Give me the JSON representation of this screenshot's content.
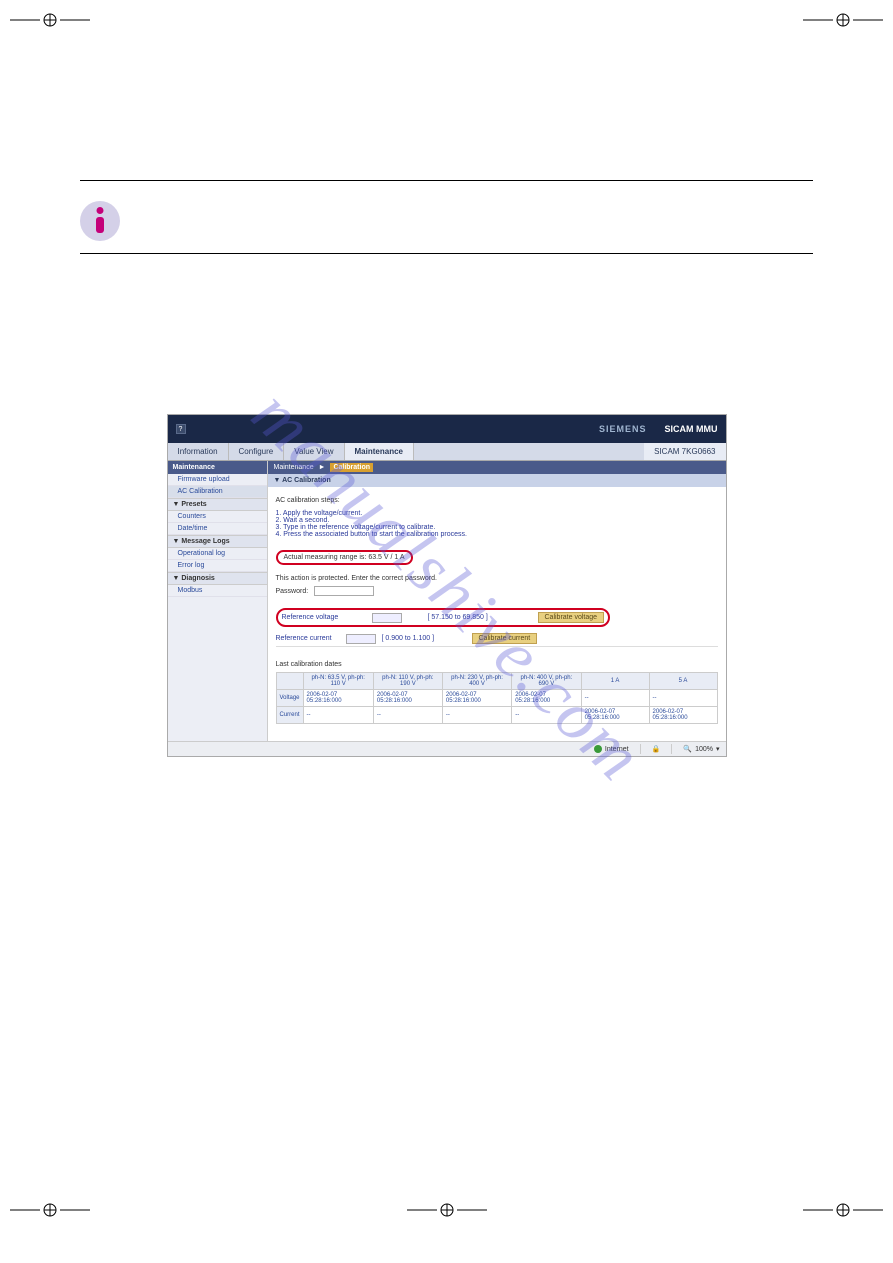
{
  "registration_mark": "⊕",
  "watermark": "manualshive.com",
  "app": {
    "help": "?",
    "brand": "SIEMENS",
    "product": "SICAM MMU",
    "device_id": "SICAM 7KG0663",
    "tabs": {
      "information": "Information",
      "configure": "Configure",
      "value_view": "Value View",
      "maintenance": "Maintenance"
    },
    "sidebar": {
      "head": "Maintenance",
      "firmware": "Firmware upload",
      "ac_cal": "AC Calibration",
      "presets_grp": "▼ Presets",
      "counters": "Counters",
      "datetime": "Date/time",
      "msglogs_grp": "▼ Message Logs",
      "oplog": "Operational log",
      "errorlog": "Error log",
      "diag_grp": "▼ Diagnosis",
      "modbus": "Modbus"
    },
    "breadcrumb": {
      "root": "Maintenance",
      "sep": "►",
      "current": "Calibration"
    },
    "panel_head": "▼ AC Calibration",
    "steps_title": "AC calibration steps:",
    "steps": [
      "1. Apply the voltage/current.",
      "2. Wait a second.",
      "3. Type in the reference voltage/current to calibrate.",
      "4. Press the associated button to start the calibration process."
    ],
    "range_text": "Actual measuring range is: 63.5 V / 1 A",
    "protected": "This action is protected. Enter the correct password.",
    "pw_label": "Password:",
    "ref": {
      "volt_label": "Reference voltage",
      "volt_range": "[ 57.150 to 69.850 ]",
      "volt_btn": "Calibrate voltage",
      "curr_label": "Reference current",
      "curr_range": "[ 0.900 to 1.100 ]",
      "curr_btn": "Calibrate current"
    },
    "cal_title": "Last calibration dates",
    "chart_data": {
      "type": "table",
      "columns": [
        "",
        "ph-N: 63.5 V, ph-ph: 110 V",
        "ph-N: 110 V, ph-ph: 190 V",
        "ph-N: 230 V, ph-ph: 400 V",
        "ph-N: 400 V, ph-ph: 690 V",
        "1 A",
        "5 A"
      ],
      "rows": [
        {
          "label": "Voltage",
          "cells": [
            "2006-02-07 05:28:16:000",
            "2006-02-07 05:28:16:000",
            "2006-02-07 05:28:16:000",
            "2006-02-07 05:28:16:000",
            "--",
            "--"
          ]
        },
        {
          "label": "Current",
          "cells": [
            "--",
            "--",
            "--",
            "--",
            "2006-02-07 05:28:16:000",
            "2006-02-07 05:28:16:000"
          ]
        }
      ]
    },
    "status": {
      "internet": "Internet",
      "zoom": "100%"
    }
  }
}
